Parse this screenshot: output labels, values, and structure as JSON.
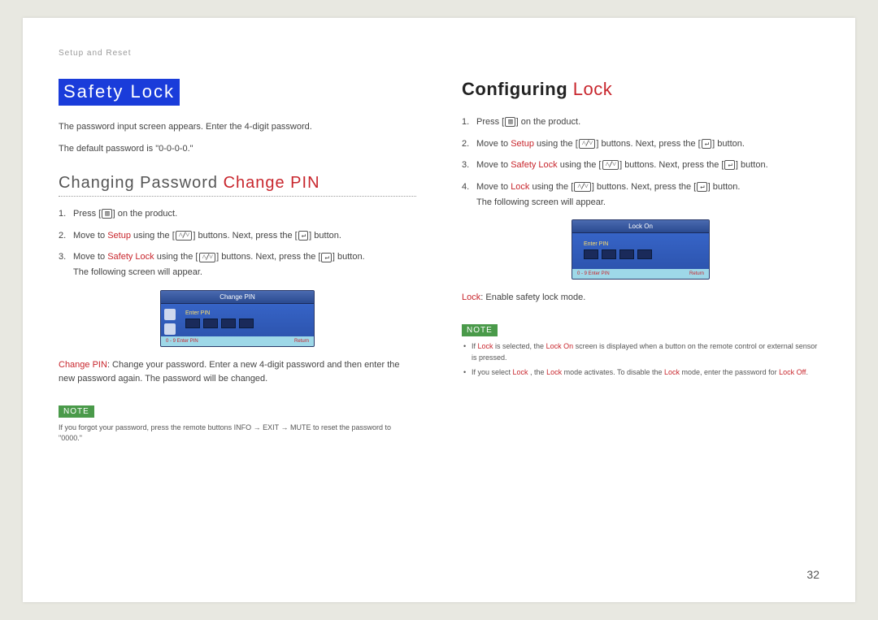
{
  "breadcrumb": "Setup and Reset",
  "left": {
    "title_box": "Safety Lock",
    "intro1": "The password input screen appears. Enter the 4-digit password.",
    "intro2": "The default password is \"0-0-0-0.\"",
    "sub_heading_main": "Changing Password ",
    "sub_heading_accent": "Change PIN",
    "steps": [
      {
        "pre": "Press [",
        "icon": "menu-icon",
        "post": "] on the product."
      },
      {
        "pre": "Move to ",
        "accent": "Setup",
        "mid": " using the [",
        "icon": "updown-icon",
        "mid2": "] buttons. Next, press the [",
        "icon2": "enter-icon",
        "post": "] button."
      },
      {
        "pre": "Move to ",
        "accent": "Safety Lock",
        "mid": " using the [",
        "icon": "updown-icon",
        "mid2": "] buttons. Next, press the [",
        "icon2": "enter-icon",
        "post": "] button.",
        "tail": "The following screen will appear."
      }
    ],
    "osd": {
      "title": "Change PIN",
      "label": "Enter PIN",
      "foot_left": "0 - 9  Enter PIN",
      "foot_right": "Return"
    },
    "after_osd_accent": "Change PIN",
    "after_osd_text": ": Change your password. Enter a new 4-digit password and then enter the new password again. The password will be changed.",
    "note_label": "NOTE",
    "note_text": "If you forgot your password, press the remote buttons INFO → EXIT → MUTE to reset the password to \"0000.\""
  },
  "right": {
    "h2_main": "Configuring ",
    "h2_accent": "Lock",
    "steps": [
      {
        "pre": "Press [",
        "icon": "menu-icon",
        "post": "] on the product."
      },
      {
        "pre": "Move to ",
        "accent": "Setup",
        "mid": " using the [",
        "icon": "updown-icon",
        "mid2": "] buttons. Next, press the [",
        "icon2": "enter-icon",
        "post": "] button."
      },
      {
        "pre": "Move to ",
        "accent": "Safety Lock",
        "mid": " using the [",
        "icon": "updown-icon",
        "mid2": "] buttons. Next, press the [",
        "icon2": "enter-icon",
        "post": "] button."
      },
      {
        "pre": "Move to ",
        "accent": "Lock",
        "mid": " using the [",
        "icon": "updown-icon",
        "mid2": "] buttons. Next, press the [",
        "icon2": "enter-icon",
        "post": "] button.",
        "tail": "The following screen will appear."
      }
    ],
    "osd": {
      "title": "Lock On",
      "label": "Enter PIN",
      "foot_left": "0 - 9  Enter PIN",
      "foot_right": "Return"
    },
    "after_osd_accent": "Lock",
    "after_osd_text": ": Enable safety lock mode.",
    "note_label": "NOTE",
    "note_items": [
      {
        "parts": [
          "If ",
          {
            "a": "Lock"
          },
          " is selected, the ",
          {
            "a": "Lock On"
          },
          " screen is displayed when a button on the remote control or external sensor is pressed."
        ]
      },
      {
        "parts": [
          "If you select ",
          {
            "a": "Lock"
          },
          " , the ",
          {
            "a": "Lock"
          },
          " mode activates. To disable the ",
          {
            "a": "Lock"
          },
          " mode, enter the password for ",
          {
            "a": "Lock Off"
          },
          "."
        ]
      }
    ]
  },
  "page_number": "32",
  "icons": {
    "menu-icon": "▥",
    "updown-icon": "˄/˅",
    "enter-icon": "↵"
  }
}
